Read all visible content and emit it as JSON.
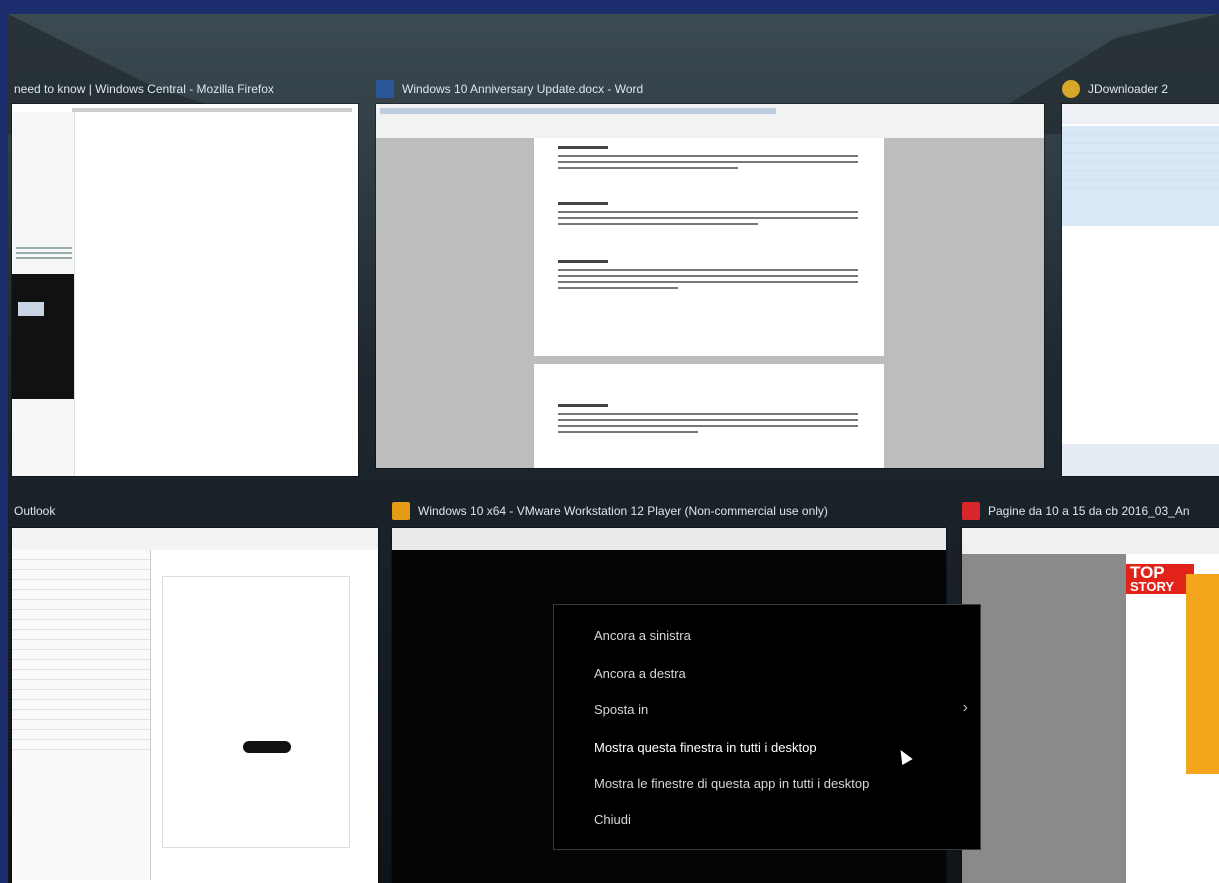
{
  "windows": {
    "firefox": {
      "title": "need to know | Windows Central - Mozilla Firefox",
      "icon": "firefox-icon"
    },
    "word": {
      "title": "Windows 10 Anniversary Update.docx - Word",
      "icon": "word-icon",
      "accent": "#2b579a"
    },
    "jdownloader": {
      "title": "JDownloader 2",
      "icon": "jdownloader-icon"
    },
    "outlook": {
      "title": "Outlook",
      "icon": "outlook-icon"
    },
    "vmware": {
      "title": "Windows 10 x64 - VMware Workstation 12 Player (Non-commercial use only)",
      "icon": "vmware-icon"
    },
    "pdf": {
      "title": "Pagine da 10 a 15 da cb 2016_03_An",
      "icon": "pdf-icon",
      "badge_top": "TOP",
      "badge_story": "STORY",
      "badge_color": "#e2231a"
    }
  },
  "context_menu": {
    "items": [
      {
        "label": "Ancora a sinistra"
      },
      {
        "label": "Ancora a destra"
      },
      {
        "label": "Sposta in",
        "submenu_icon": "chevron-right-icon"
      },
      {
        "label": "Mostra questa finestra in tutti i desktop"
      },
      {
        "label": "Mostra le finestre di questa app in tutti i desktop"
      },
      {
        "label": "Chiudi"
      }
    ]
  },
  "colors": {
    "frame": "#1c2d6e",
    "menu_bg": "#000000",
    "menu_text": "#d7d7d7"
  }
}
